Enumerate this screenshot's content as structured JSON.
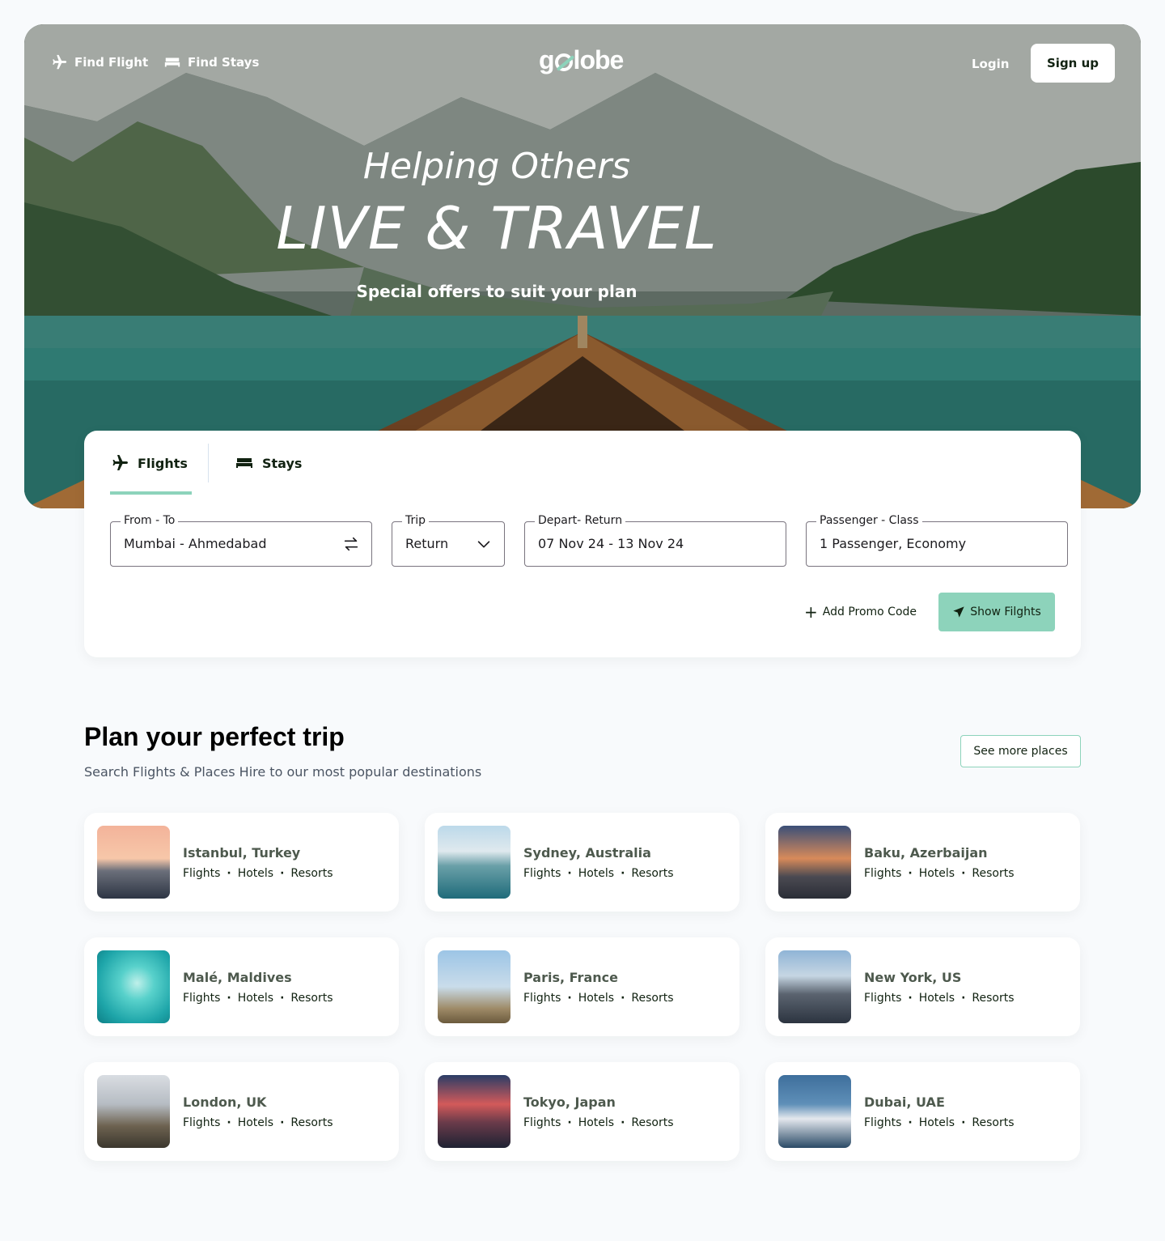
{
  "nav": {
    "find_flight": "Find Flight",
    "find_stays": "Find Stays",
    "logo": "golobe",
    "login": "Login",
    "signup": "Sign up"
  },
  "hero": {
    "line1": "Helping Others",
    "line2": "LIVE & TRAVEL",
    "line3": "Special offers to suit your plan"
  },
  "search": {
    "tabs": [
      {
        "label": "Flights",
        "icon": "airplane-icon",
        "active": true
      },
      {
        "label": "Stays",
        "icon": "bed-icon",
        "active": false
      }
    ],
    "fields": {
      "from_to": {
        "label": "From - To",
        "value": "Mumbai -  Ahmedabad"
      },
      "trip": {
        "label": "Trip",
        "value": "Return"
      },
      "dates": {
        "label": "Depart- Return",
        "value": "07 Nov 24 - 13 Nov 24"
      },
      "passengers": {
        "label": "Passenger - Class",
        "value": "1 Passenger, Economy"
      }
    },
    "promo": "Add Promo Code",
    "submit": "Show Filghts"
  },
  "plan": {
    "title": "Plan your perfect trip",
    "subtitle": "Search Flights & Places Hire to our most popular destinations",
    "see_more": "See more places",
    "link_labels": [
      "Flights",
      "Hotels",
      "Resorts"
    ],
    "destinations": [
      {
        "name": "Istanbul, Turkey"
      },
      {
        "name": "Sydney, Australia"
      },
      {
        "name": "Baku, Azerbaijan"
      },
      {
        "name": "Malé, Maldives"
      },
      {
        "name": "Paris, France"
      },
      {
        "name": "New York, US"
      },
      {
        "name": "London, UK"
      },
      {
        "name": "Tokyo, Japan"
      },
      {
        "name": "Dubai, UAE"
      }
    ]
  },
  "colors": {
    "accent": "#8DD3BB",
    "text": "#112211",
    "background": "#F8FAFC"
  }
}
